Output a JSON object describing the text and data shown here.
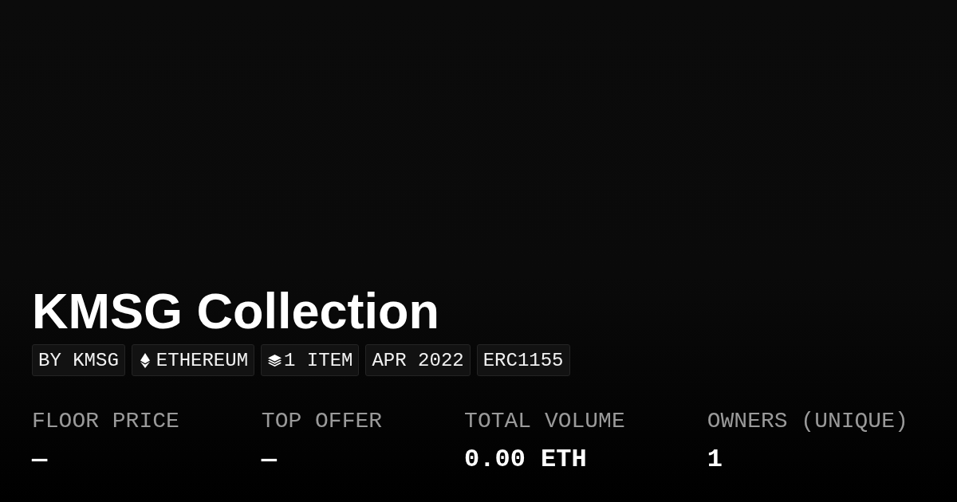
{
  "title": "KMSG Collection",
  "tags": [
    {
      "kind": "text",
      "label": "BY KMSG"
    },
    {
      "kind": "chain",
      "label": "ETHEREUM"
    },
    {
      "kind": "items",
      "label": "1 ITEM"
    },
    {
      "kind": "text",
      "label": "APR 2022"
    },
    {
      "kind": "text",
      "label": "ERC1155"
    }
  ],
  "stats": [
    {
      "label": "FLOOR PRICE",
      "value": "—"
    },
    {
      "label": "TOP OFFER",
      "value": "—"
    },
    {
      "label": "TOTAL VOLUME",
      "value": "0.00 ETH"
    },
    {
      "label": "OWNERS (UNIQUE)",
      "value": "1"
    }
  ]
}
